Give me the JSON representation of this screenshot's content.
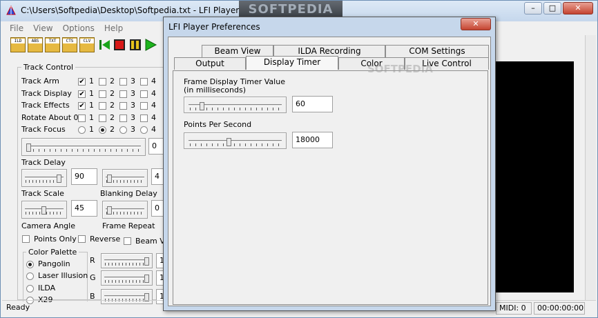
{
  "window": {
    "title": "C:\\Users\\Softpedia\\Desktop\\Softpedia.txt - LFI Player",
    "banner": "SOFTPEDIA"
  },
  "caption_buttons": {
    "minimize": "–",
    "maximize": "□",
    "close": "✕"
  },
  "menu": [
    "File",
    "View",
    "Options",
    "Help"
  ],
  "toolbar": {
    "file_buttons": [
      "ILD",
      "ABS",
      "TXT",
      "CTS",
      "CLV"
    ]
  },
  "track_control": {
    "title": "Track Control",
    "rows": [
      {
        "label": "Track Arm",
        "type": "check",
        "checked": [
          true,
          false,
          false,
          false
        ]
      },
      {
        "label": "Track Display",
        "type": "check",
        "checked": [
          true,
          false,
          false,
          false
        ]
      },
      {
        "label": "Track Effects",
        "type": "check",
        "checked": [
          true,
          false,
          false,
          false
        ]
      },
      {
        "label": "Rotate About 0",
        "type": "check",
        "checked": [
          false,
          false,
          false,
          false
        ]
      },
      {
        "label": "Track Focus",
        "type": "radio",
        "selected": 2
      }
    ],
    "numbers": [
      "1",
      "2",
      "3",
      "4"
    ],
    "focus_value": "0",
    "track_delay_label": "Track Delay",
    "track_delay_value": "90",
    "track_delay_value2": "4",
    "track_scale_label": "Track Scale",
    "blanking_delay_label": "Blanking Delay",
    "track_scale_value": "45",
    "blanking_delay_value": "0",
    "camera_angle_label": "Camera Angle",
    "frame_repeat_label": "Frame Repeat",
    "points_only": "Points Only",
    "reverse": "Reverse",
    "beam_view": "Beam Vi",
    "color_palette": {
      "title": "Color Palette",
      "options": [
        "Pangolin",
        "Laser Illusion",
        "ILDA",
        "X29"
      ],
      "selected": 0
    },
    "rgb_labels": [
      "R",
      "G",
      "B"
    ],
    "rgb_value_prefix": "1"
  },
  "statusbar": {
    "ready": "Ready",
    "midi": "MIDI: 0",
    "time": "00:00:00:00"
  },
  "dialog": {
    "title": "LFI Player Preferences",
    "close": "✕",
    "tabs_row1": [
      "Beam View",
      "ILDA Recording",
      "COM Settings"
    ],
    "tabs_row2": [
      "Output",
      "Display Timer",
      "Color",
      "Live Control"
    ],
    "active_tab": "Display Timer",
    "frame_timer_label": "Frame Display Timer Value",
    "frame_timer_sub": "(in milliseconds)",
    "frame_timer_value": "60",
    "points_per_second_label": "Points Per Second",
    "points_per_second_value": "18000",
    "frame_timer_level": 0.12,
    "pps_level": 0.42,
    "watermark": "SOFTPEDIA"
  }
}
